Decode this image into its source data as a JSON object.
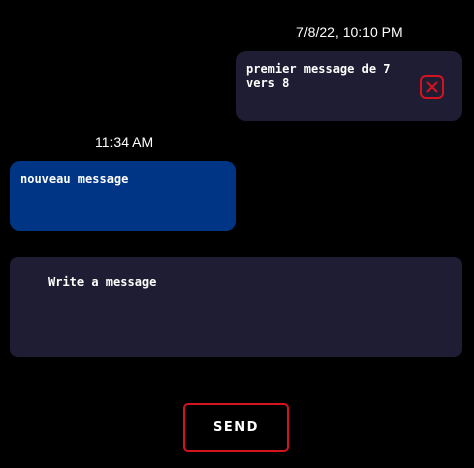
{
  "conversation": {
    "messages": [
      {
        "timestamp": "7/8/22, 10:10 PM",
        "text": "premier message de 7 vers 8",
        "direction": "sent",
        "background": "#1f1d33",
        "action_icon": "close-square-icon",
        "action_icon_color": "#d3141f"
      },
      {
        "timestamp": "11:34 AM",
        "text": "nouveau message",
        "direction": "received",
        "background": "#003586"
      }
    ]
  },
  "composer": {
    "placeholder": "Write a message",
    "value": "",
    "background": "#1f1d33"
  },
  "send_button": {
    "label": "SEND",
    "border_color": "#d3141f"
  },
  "colors": {
    "page_background": "#000000",
    "text": "#ffffff"
  }
}
